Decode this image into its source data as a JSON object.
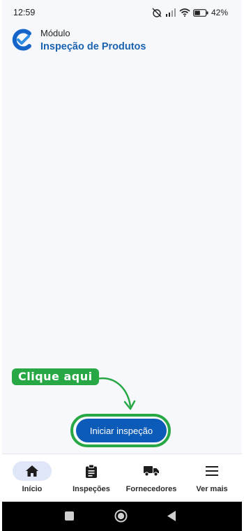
{
  "status_bar": {
    "time": "12:59",
    "battery": "42%"
  },
  "header": {
    "module_label": "Módulo",
    "title": "Inspeção de Produtos"
  },
  "hint": {
    "text": "Clique aqui"
  },
  "main": {
    "start_button": "Iniciar inspeção"
  },
  "bottom_nav": {
    "items": [
      {
        "label": "Início",
        "icon": "home-icon",
        "active": true
      },
      {
        "label": "Inspeções",
        "icon": "clipboard-icon",
        "active": false
      },
      {
        "label": "Fornecedores",
        "icon": "truck-icon",
        "active": false
      },
      {
        "label": "Ver mais",
        "icon": "menu-icon",
        "active": false
      }
    ]
  },
  "colors": {
    "brand_blue": "#0d5bb8",
    "title_blue": "#1a63b0",
    "highlight_green": "#27a845",
    "background": "#f7f8fc",
    "nav_active": "#dfe6f7"
  }
}
